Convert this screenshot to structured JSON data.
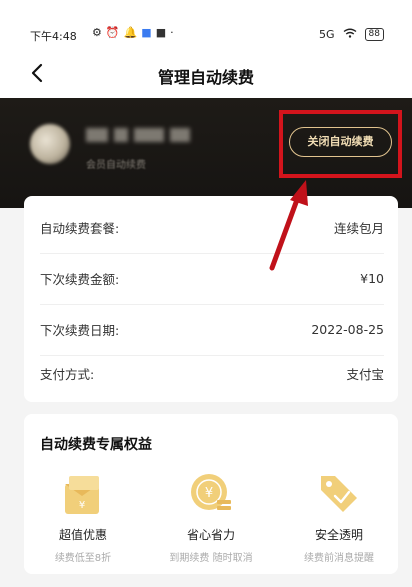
{
  "status_bar": {
    "time": "下午4:48",
    "right_text": "5G",
    "battery": "88"
  },
  "nav": {
    "title": "管理自动续费"
  },
  "header": {
    "account_sub": "会员自动续费",
    "close_button": "关闭自动续费"
  },
  "details": {
    "rows": [
      {
        "label": "自动续费套餐:",
        "value": "连续包月"
      },
      {
        "label": "下次续费金额:",
        "value": "¥10"
      },
      {
        "label": "下次续费日期:",
        "value": "2022-08-25"
      },
      {
        "label": "支付方式:",
        "value": "支付宝"
      }
    ]
  },
  "benefits": {
    "title": "自动续费专属权益",
    "items": [
      {
        "title": "超值优惠",
        "sub": "续费低至8折",
        "icon": "gift-icon"
      },
      {
        "title": "省心省力",
        "sub": "到期续费 随时取消",
        "icon": "coin-icon"
      },
      {
        "title": "安全透明",
        "sub": "续费前消息提醒",
        "icon": "tag-icon"
      }
    ]
  },
  "colors": {
    "accent_gold": "#e2c48f",
    "header_dark": "#1e1b17",
    "highlight_red": "#d3141c"
  }
}
